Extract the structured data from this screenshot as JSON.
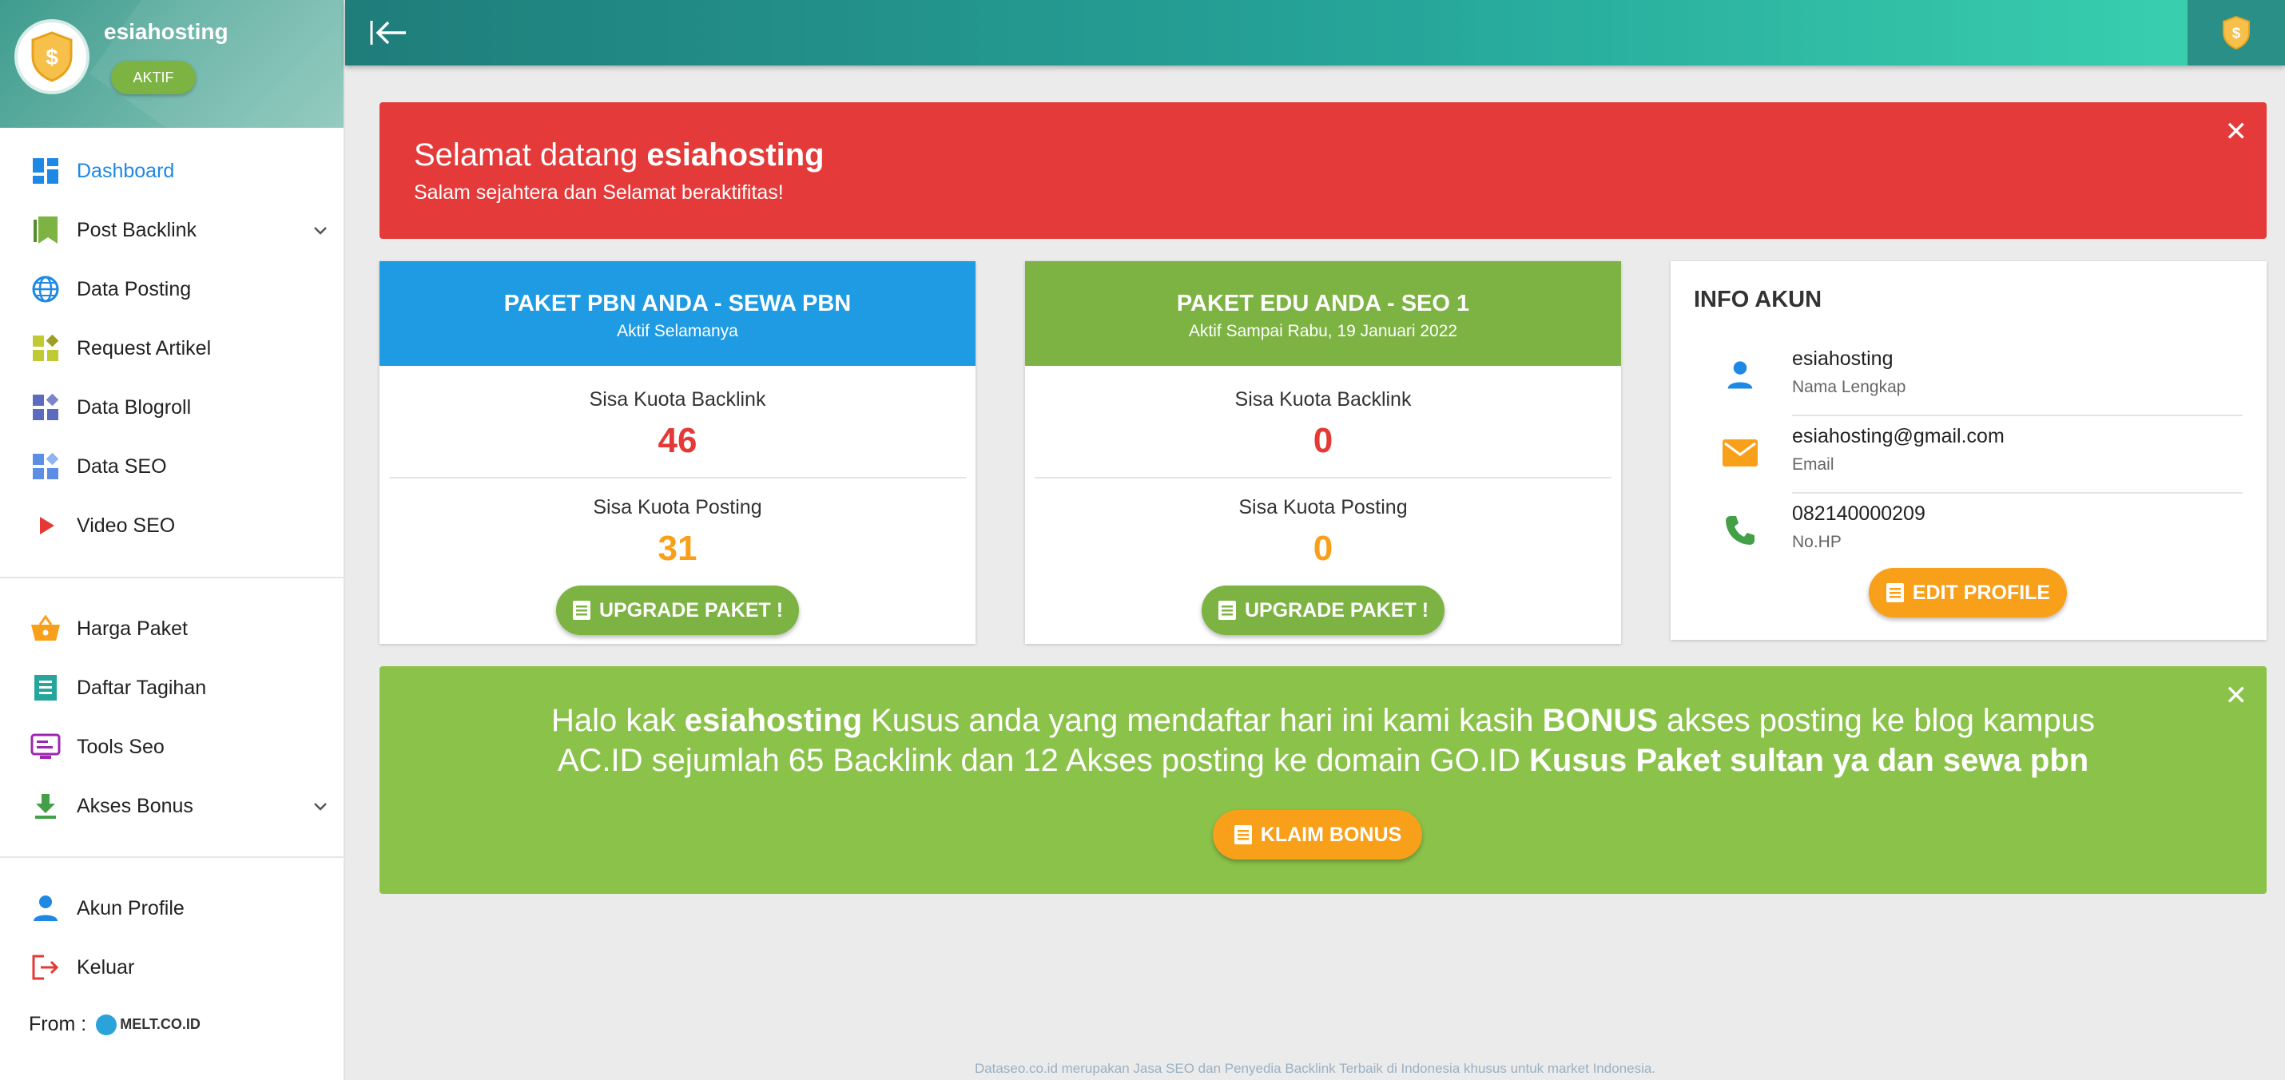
{
  "sidebar": {
    "username": "esiahosting",
    "status_badge": "AKTIF",
    "nav_main": [
      {
        "label": "Dashboard",
        "icon": "dashboard-icon"
      },
      {
        "label": "Post Backlink",
        "icon": "bookmark-icon"
      },
      {
        "label": "Data Posting",
        "icon": "globe-icon"
      },
      {
        "label": "Request Artikel",
        "icon": "widgets-icon"
      },
      {
        "label": "Data Blogroll",
        "icon": "widgets-icon"
      },
      {
        "label": "Data SEO",
        "icon": "widgets-icon"
      },
      {
        "label": "Video SEO",
        "icon": "play-icon"
      }
    ],
    "nav_secondary": [
      {
        "label": "Harga Paket",
        "icon": "basket-icon"
      },
      {
        "label": "Daftar Tagihan",
        "icon": "receipt-icon"
      },
      {
        "label": "Tools Seo",
        "icon": "tools-icon"
      },
      {
        "label": "Akses Bonus",
        "icon": "download-icon"
      }
    ],
    "nav_account": [
      {
        "label": "Akun Profile",
        "icon": "person-icon"
      },
      {
        "label": "Keluar",
        "icon": "logout-icon"
      }
    ],
    "from_label": "From :",
    "from_logo_text": "MELT.CO.ID"
  },
  "welcome": {
    "greeting": "Selamat datang ",
    "username": "esiahosting",
    "subtitle": "Salam sejahtera dan Selamat beraktifitas!",
    "close": "✕"
  },
  "pbn_card": {
    "title": "PAKET PBN ANDA - SEWA PBN",
    "subtitle": "Aktif Selamanya",
    "backlink_label": "Sisa Kuota Backlink",
    "backlink_value": "46",
    "posting_label": "Sisa Kuota Posting",
    "posting_value": "31",
    "button": "UPGRADE PAKET !"
  },
  "edu_card": {
    "title": "PAKET EDU ANDA - SEO 1",
    "subtitle": "Aktif Sampai Rabu, 19 Januari 2022",
    "backlink_label": "Sisa Kuota Backlink",
    "backlink_value": "0",
    "posting_label": "Sisa Kuota Posting",
    "posting_value": "0",
    "button": "UPGRADE PAKET !"
  },
  "info_akun": {
    "title": "INFO AKUN",
    "name_value": "esiahosting",
    "name_label": "Nama Lengkap",
    "email_value": "esiahosting@gmail.com",
    "email_label": "Email",
    "phone_value": "082140000209",
    "phone_label": "No.HP",
    "button": "EDIT PROFILE"
  },
  "bonus": {
    "p1": "Halo kak ",
    "username": "esiahosting",
    "p2": " Kusus anda yang mendaftar hari ini kami kasih ",
    "bonus_word": "BONUS",
    "p3": " akses posting ke blog kampus AC.ID sejumlah 65 Backlink dan 12 Akses posting ke domain GO.ID ",
    "p4": "Kusus Paket sultan ya dan sewa pbn",
    "button": "KLAIM BONUS",
    "close": "✕"
  },
  "footer": "Dataseo.co.id merupakan Jasa SEO dan Penyedia Backlink Terbaik di Indonesia khusus untuk market Indonesia.",
  "colors": {
    "teal": "#26a69a",
    "red": "#e53a3a",
    "blue": "#1e9be2",
    "green": "#7cb342",
    "orange": "#f9a01b"
  }
}
